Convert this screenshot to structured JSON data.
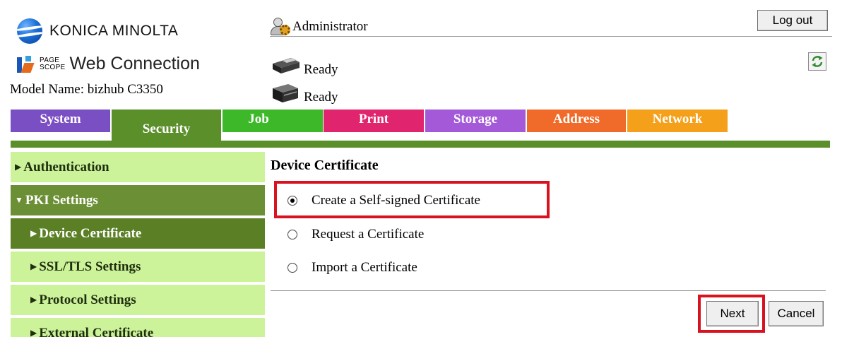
{
  "brand": {
    "name": "KONICA MINOLTA"
  },
  "pagescope": {
    "line1": "PAGE",
    "line2": "SCOPE",
    "title": "Web Connection"
  },
  "model": {
    "text": "Model Name: bizhub C3350"
  },
  "user": {
    "name": "Administrator",
    "icon": "administrator-icon"
  },
  "logout_label": "Log out",
  "refresh_icon": "refresh-icon",
  "statuses": [
    {
      "icon": "printer-icon",
      "text": "Ready"
    },
    {
      "icon": "scanner-icon",
      "text": "Ready"
    }
  ],
  "tabs": [
    {
      "label": "System",
      "color": "#7b4fc4"
    },
    {
      "label": "Security",
      "color": "#5a8f2a",
      "active": true
    },
    {
      "label": "Job",
      "color": "#3cb829"
    },
    {
      "label": "Print",
      "color": "#e0246e"
    },
    {
      "label": "Storage",
      "color": "#a45ad8"
    },
    {
      "label": "Address",
      "color": "#f06b2a"
    },
    {
      "label": "Network",
      "color": "#f5a01a"
    }
  ],
  "sidebar": {
    "items": [
      {
        "label": "Authentication",
        "arrow": "▶"
      },
      {
        "label": "PKI Settings",
        "arrow": "▼"
      },
      {
        "label": "Device Certificate",
        "arrow": "▶"
      },
      {
        "label": "SSL/TLS Settings",
        "arrow": "▶"
      },
      {
        "label": "Protocol Settings",
        "arrow": "▶"
      },
      {
        "label": "External Certificate",
        "arrow": "▶"
      }
    ]
  },
  "content": {
    "title": "Device Certificate",
    "options": [
      {
        "label": "Create a Self-signed Certificate",
        "checked": true
      },
      {
        "label": "Request a Certificate",
        "checked": false
      },
      {
        "label": "Import a Certificate",
        "checked": false
      }
    ],
    "next_label": "Next",
    "cancel_label": "Cancel"
  },
  "colors": {
    "highlight": "#d8121f",
    "sidebar_light": "#ccf29a",
    "sidebar_dark": "#6b8f34"
  }
}
